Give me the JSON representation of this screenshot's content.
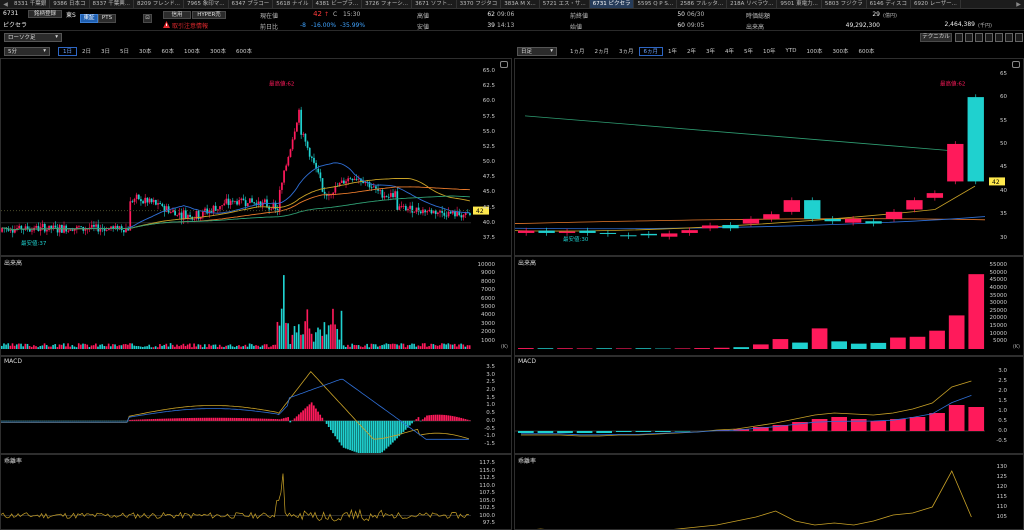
{
  "watchlist": {
    "items": [
      {
        "code": "8331",
        "name": "千葉銀"
      },
      {
        "code": "9386",
        "name": "日本コ"
      },
      {
        "code": "8337",
        "name": "千葉興..."
      },
      {
        "code": "8209",
        "name": "フレンド..."
      },
      {
        "code": "7965",
        "name": "象印マ..."
      },
      {
        "code": "6347",
        "name": "プラコー"
      },
      {
        "code": "5618",
        "name": "ナイル"
      },
      {
        "code": "4381",
        "name": "ビープラ..."
      },
      {
        "code": "3726",
        "name": "フォーシ..."
      },
      {
        "code": "3671",
        "name": "ソフト..."
      },
      {
        "code": "3370",
        "name": "フジタコ"
      },
      {
        "code": "383A",
        "name": "M X..."
      },
      {
        "code": "5721",
        "name": "エス・サ..."
      },
      {
        "code": "6731",
        "name": "ピクセラ"
      },
      {
        "code": "5595",
        "name": "Q P S..."
      },
      {
        "code": "2586",
        "name": "フルッタ..."
      },
      {
        "code": "218A",
        "name": "リベラウ..."
      },
      {
        "code": "9501",
        "name": "東電力..."
      },
      {
        "code": "5803",
        "name": "フジクラ"
      },
      {
        "code": "6146",
        "name": "ディスコ"
      },
      {
        "code": "6920",
        "name": "レーザー..."
      }
    ]
  },
  "header": {
    "code": "6731",
    "name": "ピクセラ",
    "market": "東S",
    "stock_tab": "銘柄登録",
    "exch_tse": "東証",
    "exch_pts": "PTS",
    "square_btn": "⊡",
    "credit": "信用",
    "hyper": "HYPER売",
    "alert": "取引注意情報",
    "cur_label": "現在値",
    "cur_value": "42",
    "cur_arrow": "↑",
    "cur_c": "C",
    "cur_time": "15:30",
    "prev_label": "前日比",
    "prev_value": "-8",
    "prev_pct": "-16.00%",
    "prev_pct2": "-35.99%",
    "open_label": "高値",
    "open_value": "62",
    "open_time": "09:06",
    "low_label": "安値",
    "low_value": "39",
    "low_time": "14:13",
    "pclose_label": "前終値",
    "pclose_value": "50",
    "pclose_date": "06/30",
    "start_label": "始値",
    "start_value": "60",
    "start_time": "09:05",
    "mcap_label": "時価総額",
    "mcap_value": "29",
    "mcap_unit": "(億円)",
    "vol_label": "出来高",
    "vol_value": "49,292,300",
    "vol2": "2,464,389",
    "vol2_unit": "(千円)",
    "tech_btn": "テクニカル"
  },
  "left_toolbar": {
    "chart_type": "ローソク足",
    "interval": "5分",
    "periods": [
      "1日",
      "2日",
      "3日",
      "5日",
      "30本",
      "60本",
      "100本",
      "300本",
      "600本"
    ],
    "active": "1日"
  },
  "right_toolbar": {
    "chart_type": "日足",
    "periods": [
      "1ヵ月",
      "2ヵ月",
      "3ヵ月",
      "6ヵ月",
      "1年",
      "2年",
      "3年",
      "4年",
      "5年",
      "10年",
      "YTD",
      "100本",
      "300本",
      "600本"
    ],
    "active": "6ヵ月"
  },
  "left_chart": {
    "high_label": "最高値:62",
    "low_label": "最安値:37",
    "price_tag": "42",
    "ticks": [
      "65.0",
      "62.5",
      "60.0",
      "57.5",
      "55.0",
      "52.5",
      "50.0",
      "47.5",
      "45.0",
      "42.5",
      "40.0",
      "37.5"
    ]
  },
  "right_chart": {
    "high_label": "最高値:62",
    "low_label": "最安値:30",
    "price_tag": "42",
    "ticks": [
      "65",
      "60",
      "55",
      "50",
      "45",
      "40",
      "35",
      "30"
    ]
  },
  "volume_panes": {
    "label": "出来高",
    "unit": "(K)",
    "left_ticks": [
      "10000",
      "9000",
      "8000",
      "7000",
      "6000",
      "5000",
      "4000",
      "3000",
      "2000",
      "1000"
    ],
    "right_ticks": [
      "55000",
      "50000",
      "45000",
      "40000",
      "35000",
      "30000",
      "25000",
      "20000",
      "15000",
      "10000",
      "5000"
    ]
  },
  "macd_panes": {
    "label": "MACD",
    "left_ticks": [
      "3.5",
      "3.0",
      "2.5",
      "2.0",
      "1.5",
      "1.0",
      "0.5",
      "0.0",
      "-0.5",
      "-1.0",
      "-1.5"
    ],
    "right_ticks": [
      "3.0",
      "2.5",
      "2.0",
      "1.5",
      "1.0",
      "0.5",
      "0.0",
      "-0.5"
    ]
  },
  "ratio_panes": {
    "label": "乖離率",
    "left_ticks": [
      "117.5",
      "115.0",
      "112.5",
      "110.0",
      "107.5",
      "105.0",
      "102.5",
      "100.0",
      "97.5"
    ],
    "right_ticks": [
      "130",
      "125",
      "120",
      "115",
      "110",
      "105"
    ]
  },
  "colors": {
    "up": "#ff1a5b",
    "down": "#1fd1cf",
    "ma_gold": "#c9a227",
    "ma_orange": "#e87a2b",
    "ma_blue": "#2f6fd6",
    "ma_green": "#2f9e73",
    "price_tag_bg": "#ffe94d"
  }
}
